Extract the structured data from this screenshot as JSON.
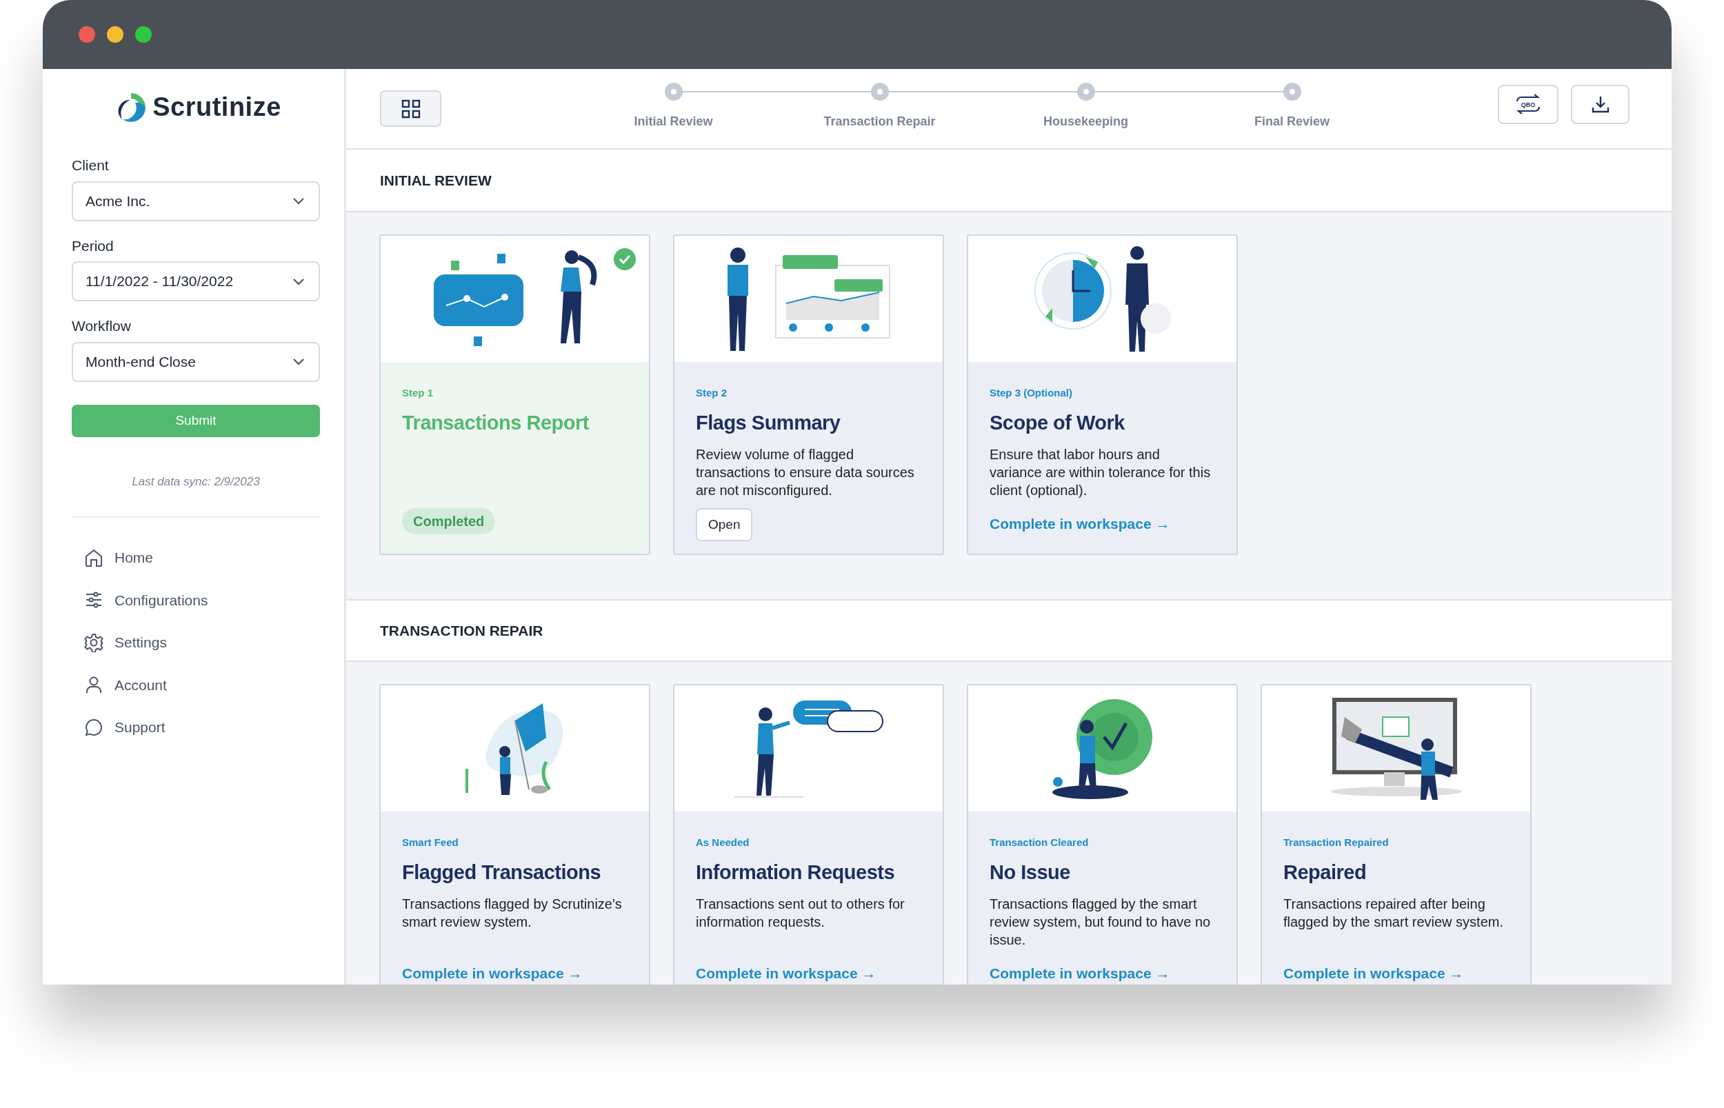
{
  "sidebar": {
    "app_name": "Scrutinize",
    "fields": [
      {
        "label": "Client",
        "value": "Acme Inc."
      },
      {
        "label": "Period",
        "value": "11/1/2022 - 11/30/2022"
      },
      {
        "label": "Workflow",
        "value": "Month-end Close"
      }
    ],
    "submit": "Submit",
    "sync_note": "Last data sync: 2/9/2023",
    "nav": [
      {
        "label": "Home"
      },
      {
        "label": "Configurations"
      },
      {
        "label": "Settings"
      },
      {
        "label": "Account"
      },
      {
        "label": "Support"
      }
    ]
  },
  "top_bar": {
    "steps": [
      {
        "label": "Initial Review"
      },
      {
        "label": "Transaction Repair"
      },
      {
        "label": "Housekeeping"
      },
      {
        "label": "Final Review"
      }
    ],
    "sync_button_label": "QBO"
  },
  "sections": [
    {
      "title": "INITIAL REVIEW",
      "cards": [
        {
          "kind": "completed",
          "tag": "Step 1",
          "title": "Transactions Report",
          "action": "Completed"
        },
        {
          "kind": "button",
          "tag": "Step 2",
          "title": "Flags Summary",
          "description": "Review volume of flagged transactions to ensure data sources are not misconfigured.",
          "action": "Open"
        },
        {
          "kind": "link",
          "tag": "Step 3 (Optional)",
          "title": "Scope of Work",
          "description": "Ensure that labor hours and variance are within tolerance for this client (optional).",
          "action": "Complete in workspace →"
        }
      ]
    },
    {
      "title": "TRANSACTION REPAIR",
      "cards": [
        {
          "kind": "link",
          "tag": "Smart Feed",
          "title": "Flagged Transactions",
          "description": "Transactions flagged by Scrutinize's smart review system.",
          "action": "Complete in workspace →"
        },
        {
          "kind": "link",
          "tag": "As Needed",
          "title": "Information Requests",
          "description": "Transactions sent out to others for information requests.",
          "action": "Complete in workspace →"
        },
        {
          "kind": "link",
          "tag": "Transaction Cleared",
          "title": "No Issue",
          "description": "Transactions flagged by the smart review system, but found to have no issue.",
          "action": "Complete in workspace →"
        },
        {
          "kind": "link",
          "tag": "Transaction Repaired",
          "title": "Repaired",
          "description": "Transactions repaired after being flagged by the smart review system.",
          "action": "Complete in workspace →"
        }
      ]
    }
  ]
}
